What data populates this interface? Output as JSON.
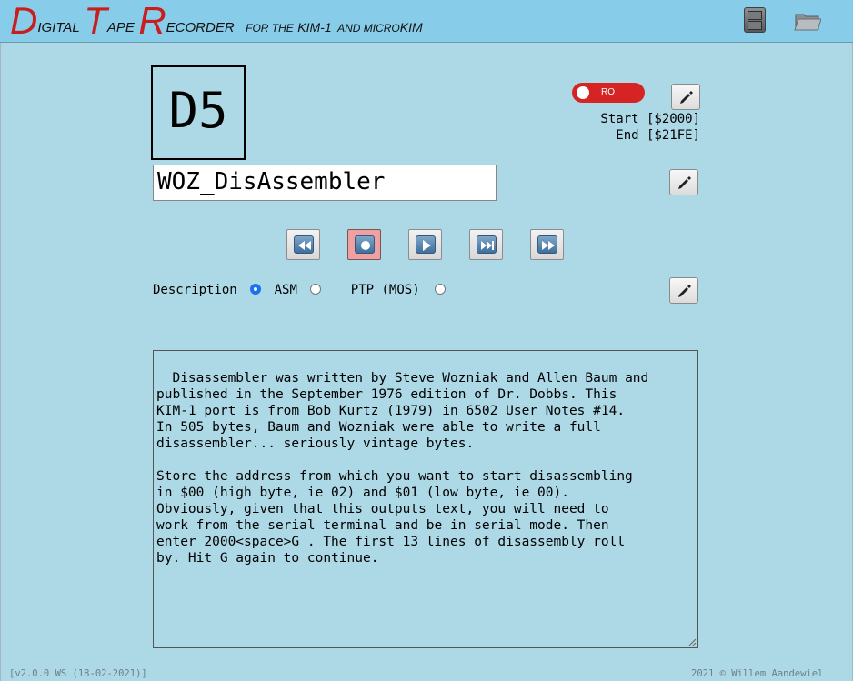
{
  "header": {
    "title_cap1": "D",
    "title_rest1": "IGITAL",
    "title_cap2": "T",
    "title_rest2": "APE",
    "title_cap3": "R",
    "title_rest3": "ECORDER",
    "subtitle_a": "FOR THE",
    "subtitle_b": "KIM-1",
    "subtitle_c": "AND MICRO",
    "subtitle_d": "KIM",
    "icons": [
      "file-cabinet-icon",
      "folder-open-icon"
    ]
  },
  "tape": {
    "id": "D5",
    "readonly_label": "RO",
    "start": "Start [$2000]",
    "end": "End [$21FE]",
    "name": "WOZ_DisAssembler"
  },
  "transport": {
    "buttons": [
      "rewind",
      "record",
      "play",
      "skip-forward",
      "fast-forward"
    ],
    "active": "record"
  },
  "description": {
    "label": "Description",
    "options": [
      "ASM",
      "PTP (MOS)"
    ],
    "selected": "Description",
    "text": "Disassembler was written by Steve Wozniak and Allen Baum and\npublished in the September 1976 edition of Dr. Dobbs. This\nKIM-1 port is from Bob Kurtz (1979) in 6502 User Notes #14.\nIn 505 bytes, Baum and Wozniak were able to write a full\ndisassembler... seriously vintage bytes.\n\nStore the address from which you want to start disassembling\nin $00 (high byte, ie 02) and $01 (low byte, ie 00).\nObviously, given that this outputs text, you will need to\nwork from the serial terminal and be in serial mode. Then\nenter 2000<space>G . The first 13 lines of disassembly roll\nby. Hit G again to continue."
  },
  "footer": {
    "version": "[v2.0.0 WS (18-02-2021)]",
    "copyright": "2021 © Willem Aandewiel"
  },
  "colors": {
    "background": "#add8e6",
    "header": "#87cdea",
    "accent_red": "#c81e1e",
    "toggle_red": "#d62424",
    "record_active": "#f0a0a0"
  }
}
